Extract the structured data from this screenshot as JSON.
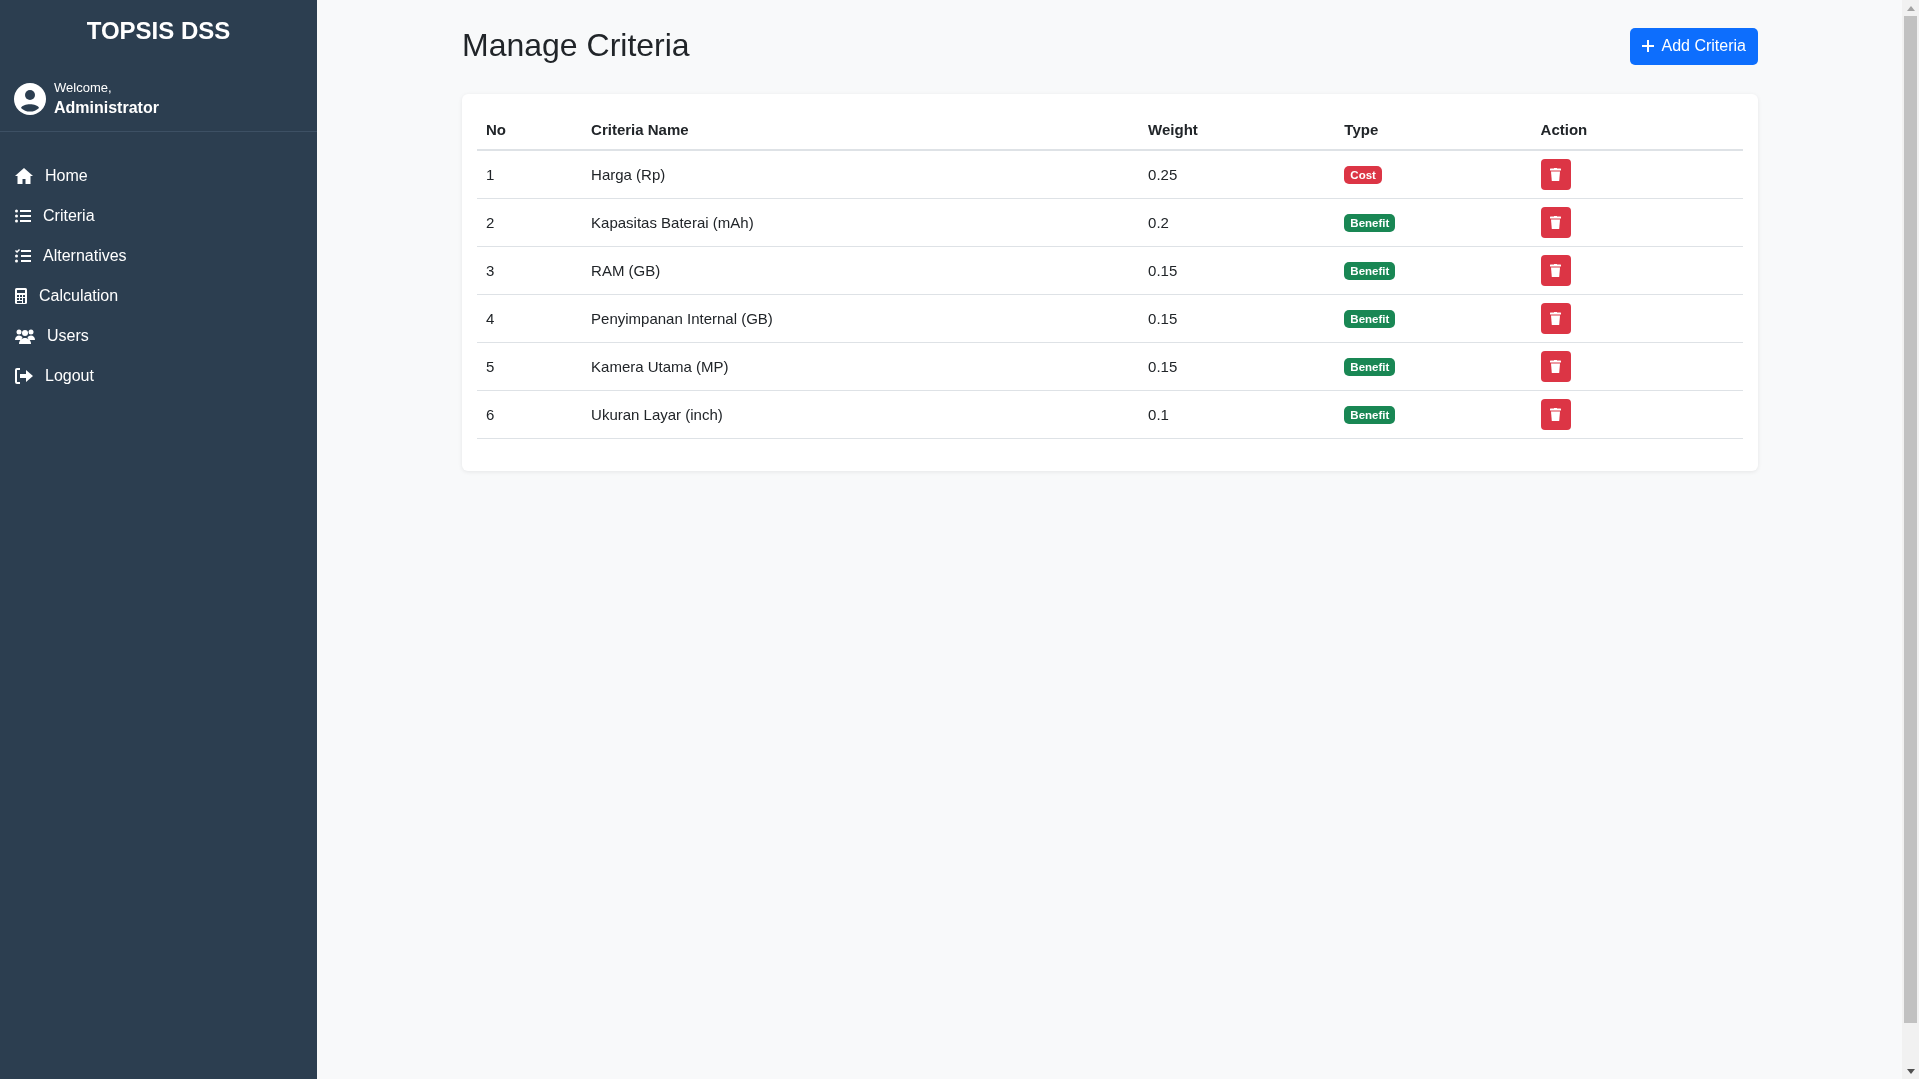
{
  "sidebar": {
    "brand": "TOPSIS DSS",
    "welcome": "Welcome,",
    "user": "Administrator",
    "items": [
      {
        "label": "Home",
        "kind": "home"
      },
      {
        "label": "Criteria",
        "kind": "list"
      },
      {
        "label": "Alternatives",
        "kind": "checklist"
      },
      {
        "label": "Calculation",
        "kind": "calculator"
      },
      {
        "label": "Users",
        "kind": "users"
      },
      {
        "label": "Logout",
        "kind": "logout"
      }
    ]
  },
  "page": {
    "title": "Manage Criteria",
    "add_button": "Add Criteria"
  },
  "table": {
    "columns": [
      "No",
      "Criteria Name",
      "Weight",
      "Type",
      "Action"
    ],
    "rows": [
      {
        "no": "1",
        "name": "Harga (Rp)",
        "weight": "0.25",
        "type": "Cost",
        "kind": "cost"
      },
      {
        "no": "2",
        "name": "Kapasitas Baterai (mAh)",
        "weight": "0.2",
        "type": "Benefit",
        "kind": "benefit"
      },
      {
        "no": "3",
        "name": "RAM (GB)",
        "weight": "0.15",
        "type": "Benefit",
        "kind": "benefit"
      },
      {
        "no": "4",
        "name": "Penyimpanan Internal (GB)",
        "weight": "0.15",
        "type": "Benefit",
        "kind": "benefit"
      },
      {
        "no": "5",
        "name": "Kamera Utama (MP)",
        "weight": "0.15",
        "type": "Benefit",
        "kind": "benefit"
      },
      {
        "no": "6",
        "name": "Ukuran Layar (inch)",
        "weight": "0.1",
        "type": "Benefit",
        "kind": "benefit"
      }
    ]
  }
}
